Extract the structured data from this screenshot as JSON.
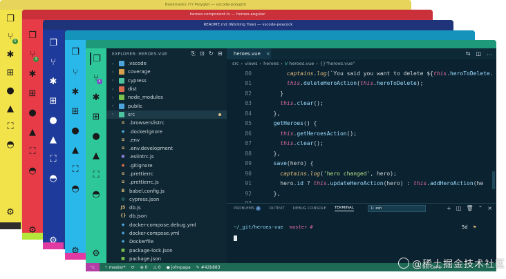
{
  "windows": [
    {
      "title": "Bookmarks ??? Polyglot — vscode-polyglot"
    },
    {
      "title": "heroes.component.ts — heroes-angular"
    },
    {
      "title": "README.md (Working Tree) — vscode-peacock"
    },
    {
      "title": ""
    },
    {
      "title": ""
    }
  ],
  "badges": {
    "w1_scm": "5",
    "w2_scm": "3",
    "w5_scm": "4"
  },
  "explorer": {
    "header": "EXPLORER: HEROES-VUE",
    "tools": [
      "new-file",
      "new-folder",
      "refresh",
      "collapse"
    ],
    "items": [
      {
        "name": ".vscode",
        "kind": "folder",
        "color": "#4ea4d9"
      },
      {
        "name": "coverage",
        "kind": "folder",
        "color": "#d9a04e"
      },
      {
        "name": "cypress",
        "kind": "folder",
        "color": "#4ec3a0"
      },
      {
        "name": "dist",
        "kind": "folder",
        "color": "#d96b4e"
      },
      {
        "name": "node_modules",
        "kind": "folder",
        "color": "#7bbf4e"
      },
      {
        "name": "public",
        "kind": "folder",
        "color": "#4ea4d9"
      },
      {
        "name": "src",
        "kind": "folder",
        "color": "#4ec3a0",
        "selected": true
      },
      {
        "name": ".browserslistrc",
        "kind": "file",
        "color": "#e6c07b",
        "glyph": "≡"
      },
      {
        "name": ".dockerignore",
        "kind": "file",
        "color": "#4ea4d9",
        "glyph": "◆"
      },
      {
        "name": ".env",
        "kind": "file",
        "color": "#e6c07b",
        "glyph": "≡"
      },
      {
        "name": ".env.development",
        "kind": "file",
        "color": "#e6c07b",
        "glyph": "≡"
      },
      {
        "name": ".eslintrc.js",
        "kind": "file",
        "color": "#8a7fd9",
        "glyph": "●"
      },
      {
        "name": ".gitignore",
        "kind": "file",
        "color": "#e06c4e",
        "glyph": "◆"
      },
      {
        "name": ".prettierrc",
        "kind": "file",
        "color": "#e6c07b",
        "glyph": "≡"
      },
      {
        "name": ".prettierrc.js",
        "kind": "file",
        "color": "#e6c07b",
        "glyph": "≡"
      },
      {
        "name": "babel.config.js",
        "kind": "file",
        "color": "#e6c07b",
        "glyph": "B"
      },
      {
        "name": "cypress.json",
        "kind": "file",
        "color": "#4ec3a0",
        "glyph": "◎"
      },
      {
        "name": "db.js",
        "kind": "file",
        "color": "#e6c07b",
        "glyph": "JS"
      },
      {
        "name": "db.json",
        "kind": "file",
        "color": "#e6c07b",
        "glyph": "{}"
      },
      {
        "name": "docker-compose.debug.yml",
        "kind": "file",
        "color": "#4ea4d9",
        "glyph": "◆"
      },
      {
        "name": "docker-compose.yml",
        "kind": "file",
        "color": "#4ea4d9",
        "glyph": "◆"
      },
      {
        "name": "Dockerfile",
        "kind": "file",
        "color": "#4ea4d9",
        "glyph": "◆"
      },
      {
        "name": "package-lock.json",
        "kind": "file",
        "color": "#7bbf4e",
        "glyph": "■"
      },
      {
        "name": "package.json",
        "kind": "file",
        "color": "#7bbf4e",
        "glyph": "■"
      }
    ]
  },
  "editor": {
    "tab_label": "heroes.vue",
    "breadcrumbs": [
      "src",
      "views",
      "heroes",
      "heroes.vue",
      "{}\"heroes.vue\""
    ],
    "lines": [
      {
        "n": "80",
        "parts": [
          [
            "pl",
            "      "
          ],
          [
            "obj",
            "captains"
          ],
          [
            "pl",
            "."
          ],
          [
            "obj",
            "log"
          ],
          [
            "pl",
            "(`You said you want to delete ${"
          ],
          [
            "this",
            "this"
          ],
          [
            "pl",
            "."
          ],
          [
            "fn",
            "heroToDelete"
          ],
          [
            "pl",
            "."
          ]
        ]
      },
      {
        "n": "81",
        "parts": [
          [
            "pl",
            "      "
          ],
          [
            "this",
            "this"
          ],
          [
            "pl",
            "."
          ],
          [
            "fn",
            "deleteHeroAction"
          ],
          [
            "pl",
            "("
          ],
          [
            "this",
            "this"
          ],
          [
            "pl",
            "."
          ],
          [
            "fn",
            "heroToDelete"
          ],
          [
            "pl",
            ");"
          ]
        ]
      },
      {
        "n": "82",
        "parts": [
          [
            "pl",
            "    }"
          ]
        ]
      },
      {
        "n": "83",
        "parts": [
          [
            "pl",
            "    "
          ],
          [
            "this",
            "this"
          ],
          [
            "pl",
            "."
          ],
          [
            "fn",
            "clear"
          ],
          [
            "pl",
            "();"
          ]
        ]
      },
      {
        "n": "84",
        "parts": [
          [
            "pl",
            "  },"
          ]
        ]
      },
      {
        "n": "85",
        "parts": [
          [
            "pl",
            "  "
          ],
          [
            "fn",
            "getHeroes"
          ],
          [
            "pl",
            "() {"
          ]
        ]
      },
      {
        "n": "86",
        "parts": [
          [
            "pl",
            "    "
          ],
          [
            "this",
            "this"
          ],
          [
            "pl",
            "."
          ],
          [
            "fn",
            "getHeroesAction"
          ],
          [
            "pl",
            "();"
          ]
        ]
      },
      {
        "n": "87",
        "parts": [
          [
            "pl",
            "    "
          ],
          [
            "this",
            "this"
          ],
          [
            "pl",
            "."
          ],
          [
            "fn",
            "clear"
          ],
          [
            "pl",
            "();"
          ]
        ]
      },
      {
        "n": "88",
        "parts": [
          [
            "pl",
            "  },"
          ]
        ]
      },
      {
        "n": "89",
        "parts": [
          [
            "pl",
            "  "
          ],
          [
            "fn",
            "save"
          ],
          [
            "pl",
            "(hero) {"
          ]
        ]
      },
      {
        "n": "90",
        "parts": [
          [
            "pl",
            "    "
          ],
          [
            "obj",
            "captains"
          ],
          [
            "pl",
            "."
          ],
          [
            "obj",
            "log"
          ],
          [
            "pl",
            "("
          ],
          [
            "str",
            "'hero changed'"
          ],
          [
            "pl",
            ", hero);"
          ]
        ]
      },
      {
        "n": "91",
        "parts": [
          [
            "pl",
            "    hero."
          ],
          [
            "fn",
            "id"
          ],
          [
            "pl",
            " ? "
          ],
          [
            "this",
            "this"
          ],
          [
            "pl",
            "."
          ],
          [
            "fn",
            "updateHeroAction"
          ],
          [
            "pl",
            "(hero) : "
          ],
          [
            "this",
            "this"
          ],
          [
            "pl",
            "."
          ],
          [
            "fn",
            "addHeroAction"
          ],
          [
            "pl",
            "(he"
          ]
        ]
      },
      {
        "n": "92",
        "parts": [
          [
            "pl",
            "  },"
          ]
        ]
      },
      {
        "n": "93",
        "parts": [
          [
            "pl",
            ""
          ]
        ]
      }
    ]
  },
  "panel": {
    "tabs": [
      "PROBLEMS",
      "OUTPUT",
      "DEBUG CONSOLE",
      "TERMINAL"
    ],
    "problems_count": "2",
    "terminal_select": "1: zsh",
    "prompt_path": "~/_git/heroes-vue",
    "prompt_branch": "master",
    "prompt_mark": "#",
    "right_time": "5d",
    "right_flag": "⚑"
  },
  "statusbar": {
    "branch": "master*",
    "sync": "⟳",
    "errors": "⊗ 0",
    "warnings": "⚠ 0",
    "user": "johnpapa",
    "commit": "#42b883",
    "position": "Ln 89, Col 1"
  },
  "watermark": "@稀土掘金技术社区",
  "colors": {
    "yellow": "#f3e34a",
    "red": "#e73c47",
    "navy": "#1e3a9a",
    "cyan": "#2ab8ea",
    "green": "#2ec79a",
    "status_green": "#1f6a55"
  }
}
